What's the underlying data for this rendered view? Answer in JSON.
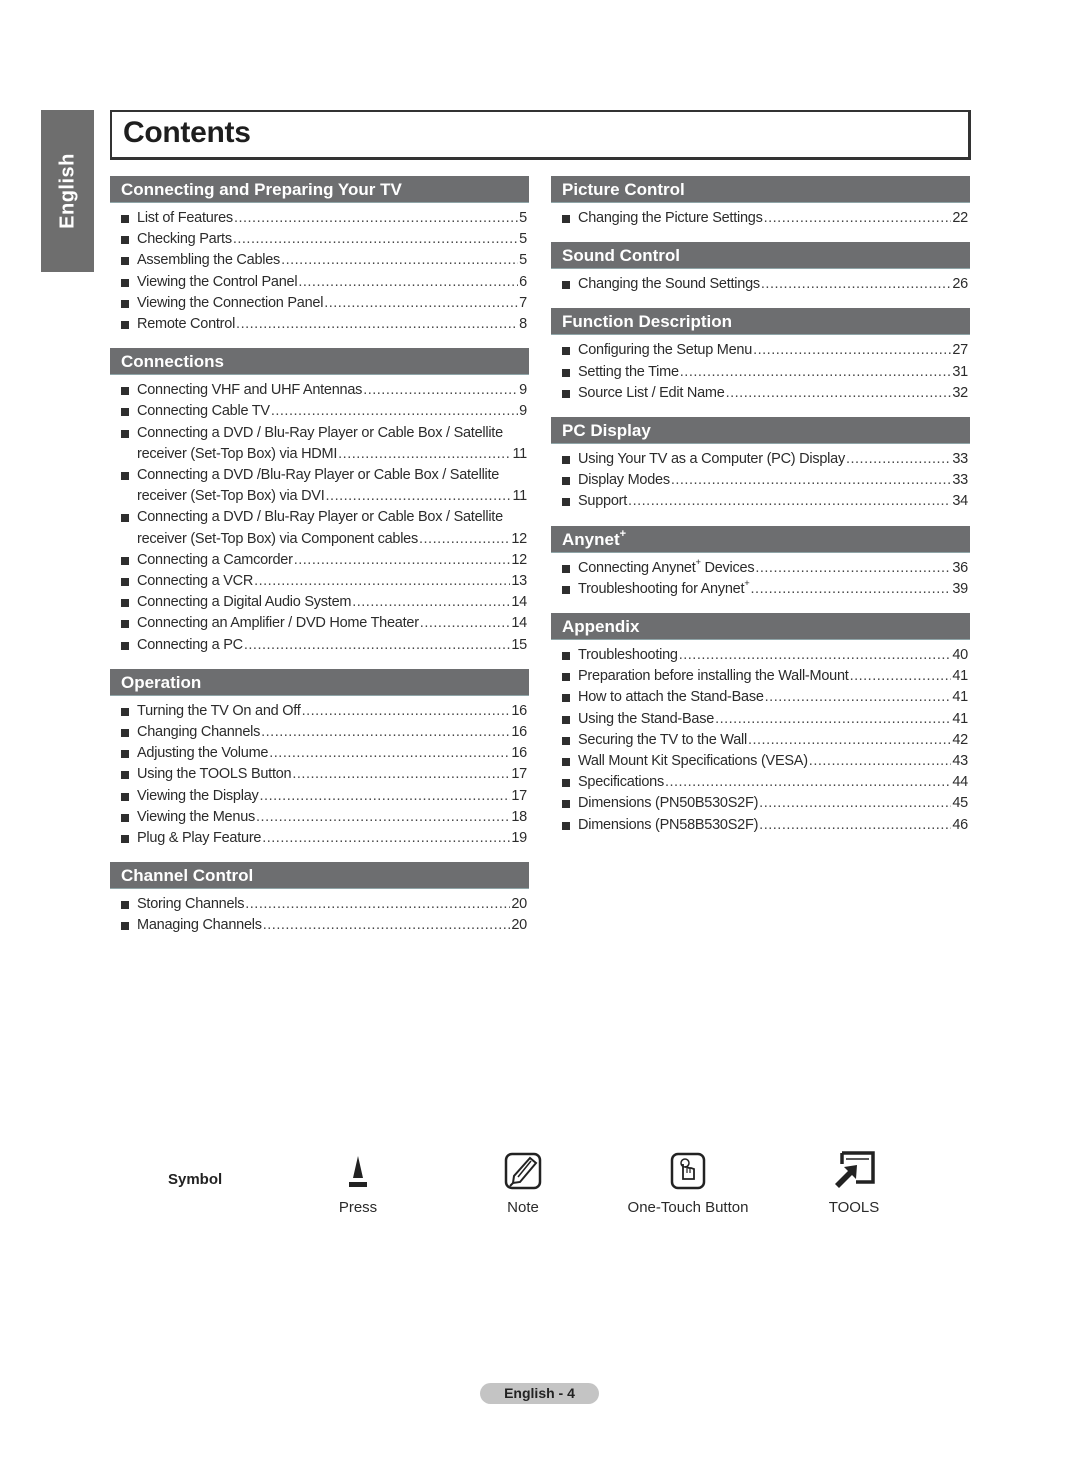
{
  "language_tab": "English",
  "title": "Contents",
  "left_sections": [
    {
      "heading": "Connecting and Preparing Your TV",
      "entries": [
        {
          "text": "List of Features",
          "page": "5"
        },
        {
          "text": "Checking Parts",
          "page": "5"
        },
        {
          "text": "Assembling the Cables",
          "page": "5"
        },
        {
          "text": "Viewing the Control Panel",
          "page": "6"
        },
        {
          "text": "Viewing the Connection Panel",
          "page": "7"
        },
        {
          "text": "Remote Control",
          "page": "8"
        }
      ]
    },
    {
      "heading": "Connections",
      "entries": [
        {
          "text": "Connecting VHF and UHF Antennas",
          "page": "9"
        },
        {
          "text": "Connecting Cable TV",
          "page": "9"
        },
        {
          "first_line": "Connecting a DVD / Blu-Ray Player or Cable Box / Satellite",
          "text": "receiver (Set-Top Box) via HDMI",
          "page": "11"
        },
        {
          "first_line": "Connecting a DVD /Blu-Ray Player or Cable Box / Satellite",
          "text": "receiver (Set-Top Box) via DVI",
          "page": "11"
        },
        {
          "first_line": "Connecting a DVD / Blu-Ray Player or Cable Box / Satellite",
          "text": "receiver (Set-Top Box) via Component cables",
          "page": "12"
        },
        {
          "text": "Connecting a Camcorder",
          "page": "12"
        },
        {
          "text": "Connecting a VCR",
          "page": "13"
        },
        {
          "text": "Connecting a Digital Audio System",
          "page": "14"
        },
        {
          "text": "Connecting an Amplifier / DVD Home Theater",
          "page": "14"
        },
        {
          "text": "Connecting a PC",
          "page": "15"
        }
      ]
    },
    {
      "heading": "Operation",
      "entries": [
        {
          "text": "Turning the TV On and Off",
          "page": "16"
        },
        {
          "text": "Changing Channels",
          "page": "16"
        },
        {
          "text": "Adjusting the Volume",
          "page": "16"
        },
        {
          "text": "Using the TOOLS Button",
          "page": "17"
        },
        {
          "text": "Viewing the Display",
          "page": "17"
        },
        {
          "text": "Viewing the Menus",
          "page": "18"
        },
        {
          "text": "Plug & Play Feature",
          "page": "19"
        }
      ]
    },
    {
      "heading": "Channel Control",
      "entries": [
        {
          "text": "Storing Channels",
          "page": "20"
        },
        {
          "text": "Managing Channels",
          "page": "20"
        }
      ]
    }
  ],
  "right_sections": [
    {
      "heading": "Picture Control",
      "entries": [
        {
          "text": "Changing the Picture Settings",
          "page": "22"
        }
      ]
    },
    {
      "heading": "Sound Control",
      "entries": [
        {
          "text": "Changing the Sound Settings",
          "page": "26"
        }
      ]
    },
    {
      "heading": "Function Description",
      "entries": [
        {
          "text": "Configuring the Setup Menu",
          "page": "27"
        },
        {
          "text": "Setting the Time",
          "page": "31"
        },
        {
          "text": "Source List / Edit Name",
          "page": "32"
        }
      ]
    },
    {
      "heading": "PC Display",
      "entries": [
        {
          "text": "Using Your TV as a Computer (PC) Display",
          "page": "33"
        },
        {
          "text": "Display Modes",
          "page": "33"
        },
        {
          "text": "Support",
          "page": "34"
        }
      ]
    },
    {
      "heading": "Anynet",
      "heading_sup": "+",
      "entries": [
        {
          "text": "Connecting Anynet",
          "sup": "+",
          "text_after": " Devices",
          "page": "36"
        },
        {
          "text": "Troubleshooting for Anynet",
          "sup": "+",
          "text_after": "",
          "page": "39"
        }
      ]
    },
    {
      "heading": "Appendix",
      "entries": [
        {
          "text": "Troubleshooting",
          "page": "40"
        },
        {
          "text": "Preparation before installing the Wall-Mount",
          "page": "41"
        },
        {
          "text": "How to attach the Stand-Base",
          "page": "41"
        },
        {
          "text": "Using the Stand-Base",
          "page": "41"
        },
        {
          "text": "Securing the TV to the Wall",
          "page": "42"
        },
        {
          "text": "Wall Mount Kit Specifications (VESA)",
          "page": "43"
        },
        {
          "text": "Specifications",
          "page": "44"
        },
        {
          "text": "Dimensions (PN50B530S2F)",
          "page": "45"
        },
        {
          "text": "Dimensions (PN58B530S2F)",
          "page": "46"
        }
      ]
    }
  ],
  "symbols": {
    "label": "Symbol",
    "items": [
      {
        "icon": "press-icon",
        "caption": "Press"
      },
      {
        "icon": "note-icon",
        "caption": "Note"
      },
      {
        "icon": "one-touch-button-icon",
        "caption": "One-Touch Button"
      },
      {
        "icon": "tools-icon",
        "caption": "TOOLS"
      }
    ]
  },
  "footer": {
    "page_label": "English - 4"
  },
  "colors": {
    "section_header_bg": "#6d6e70",
    "lang_tab_bg": "#6e6e6e",
    "footer_bg": "#c4c4c4"
  }
}
